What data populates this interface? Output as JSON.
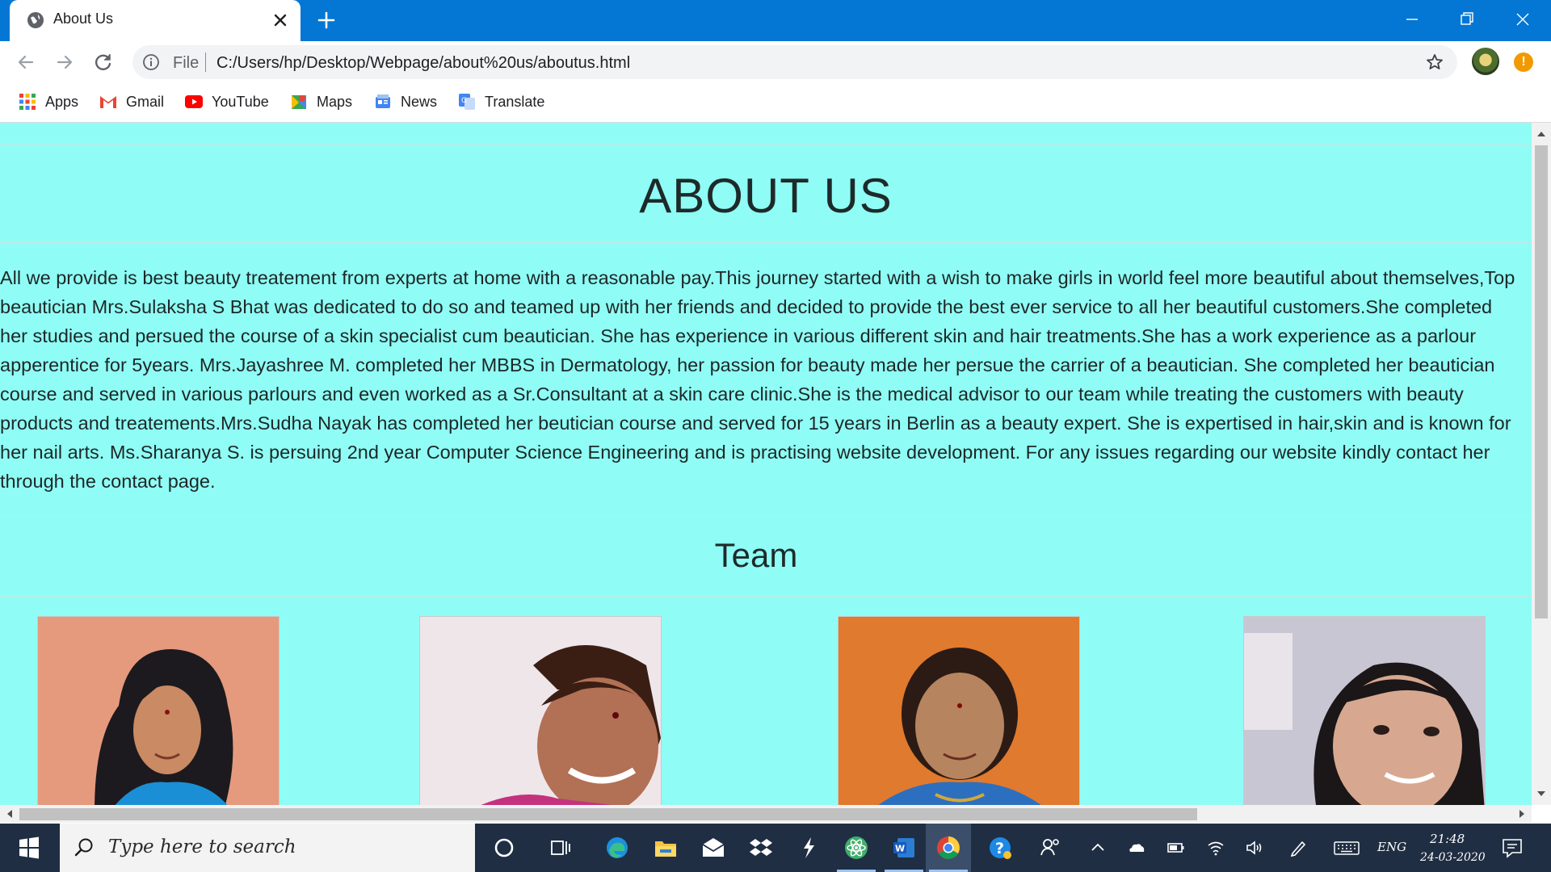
{
  "browser": {
    "tab_title": "About Us",
    "file_label": "File",
    "url": "C:/Users/hp/Desktop/Webpage/about%20us/aboutus.html"
  },
  "bookmarks": [
    {
      "label": "Apps",
      "icon": "apps-grid-icon"
    },
    {
      "label": "Gmail",
      "icon": "gmail-icon"
    },
    {
      "label": "YouTube",
      "icon": "youtube-icon"
    },
    {
      "label": "Maps",
      "icon": "maps-icon"
    },
    {
      "label": "News",
      "icon": "news-icon"
    },
    {
      "label": "Translate",
      "icon": "translate-icon"
    }
  ],
  "page": {
    "heading": "ABOUT US",
    "about_text": "All we provide is best beauty treatement from experts at home with a reasonable pay.This journey started with a wish to make girls in world feel more beautiful about themselves,Top beautician Mrs.Sulaksha S Bhat was dedicated to do so and teamed up with her friends and decided to provide the best ever service to all her beautiful customers.She completed her studies and persued the course of a skin specialist cum beautician. She has experience in various different skin and hair treatments.She has a work experience as a parlour apperentice for 5years. Mrs.Jayashree M. completed her MBBS in Dermatology, her passion for beauty made her persue the carrier of a beautician. She completed her beautician course and served in various parlours and even worked as a Sr.Consultant at a skin care clinic.She is the medical advisor to our team while treating the customers with beauty products and treatements.Mrs.Sudha Nayak has completed her beutician course and served for 15 years in Berlin as a beauty expert. She is expertised in hair,skin and is known for her nail arts. Ms.Sharanya S. is persuing 2nd year Computer Science Engineering and is practising website development. For any issues regarding our website kindly contact her through the contact page.",
    "team_heading": "Team"
  },
  "colors": {
    "page_background": "#8ffdf6",
    "titlebar": "#0477d4",
    "taskbar": "#1f2e43"
  },
  "taskbar": {
    "search_placeholder": "Type here to search",
    "language": "ENG",
    "time": "21:48",
    "date": "24-03-2020"
  }
}
